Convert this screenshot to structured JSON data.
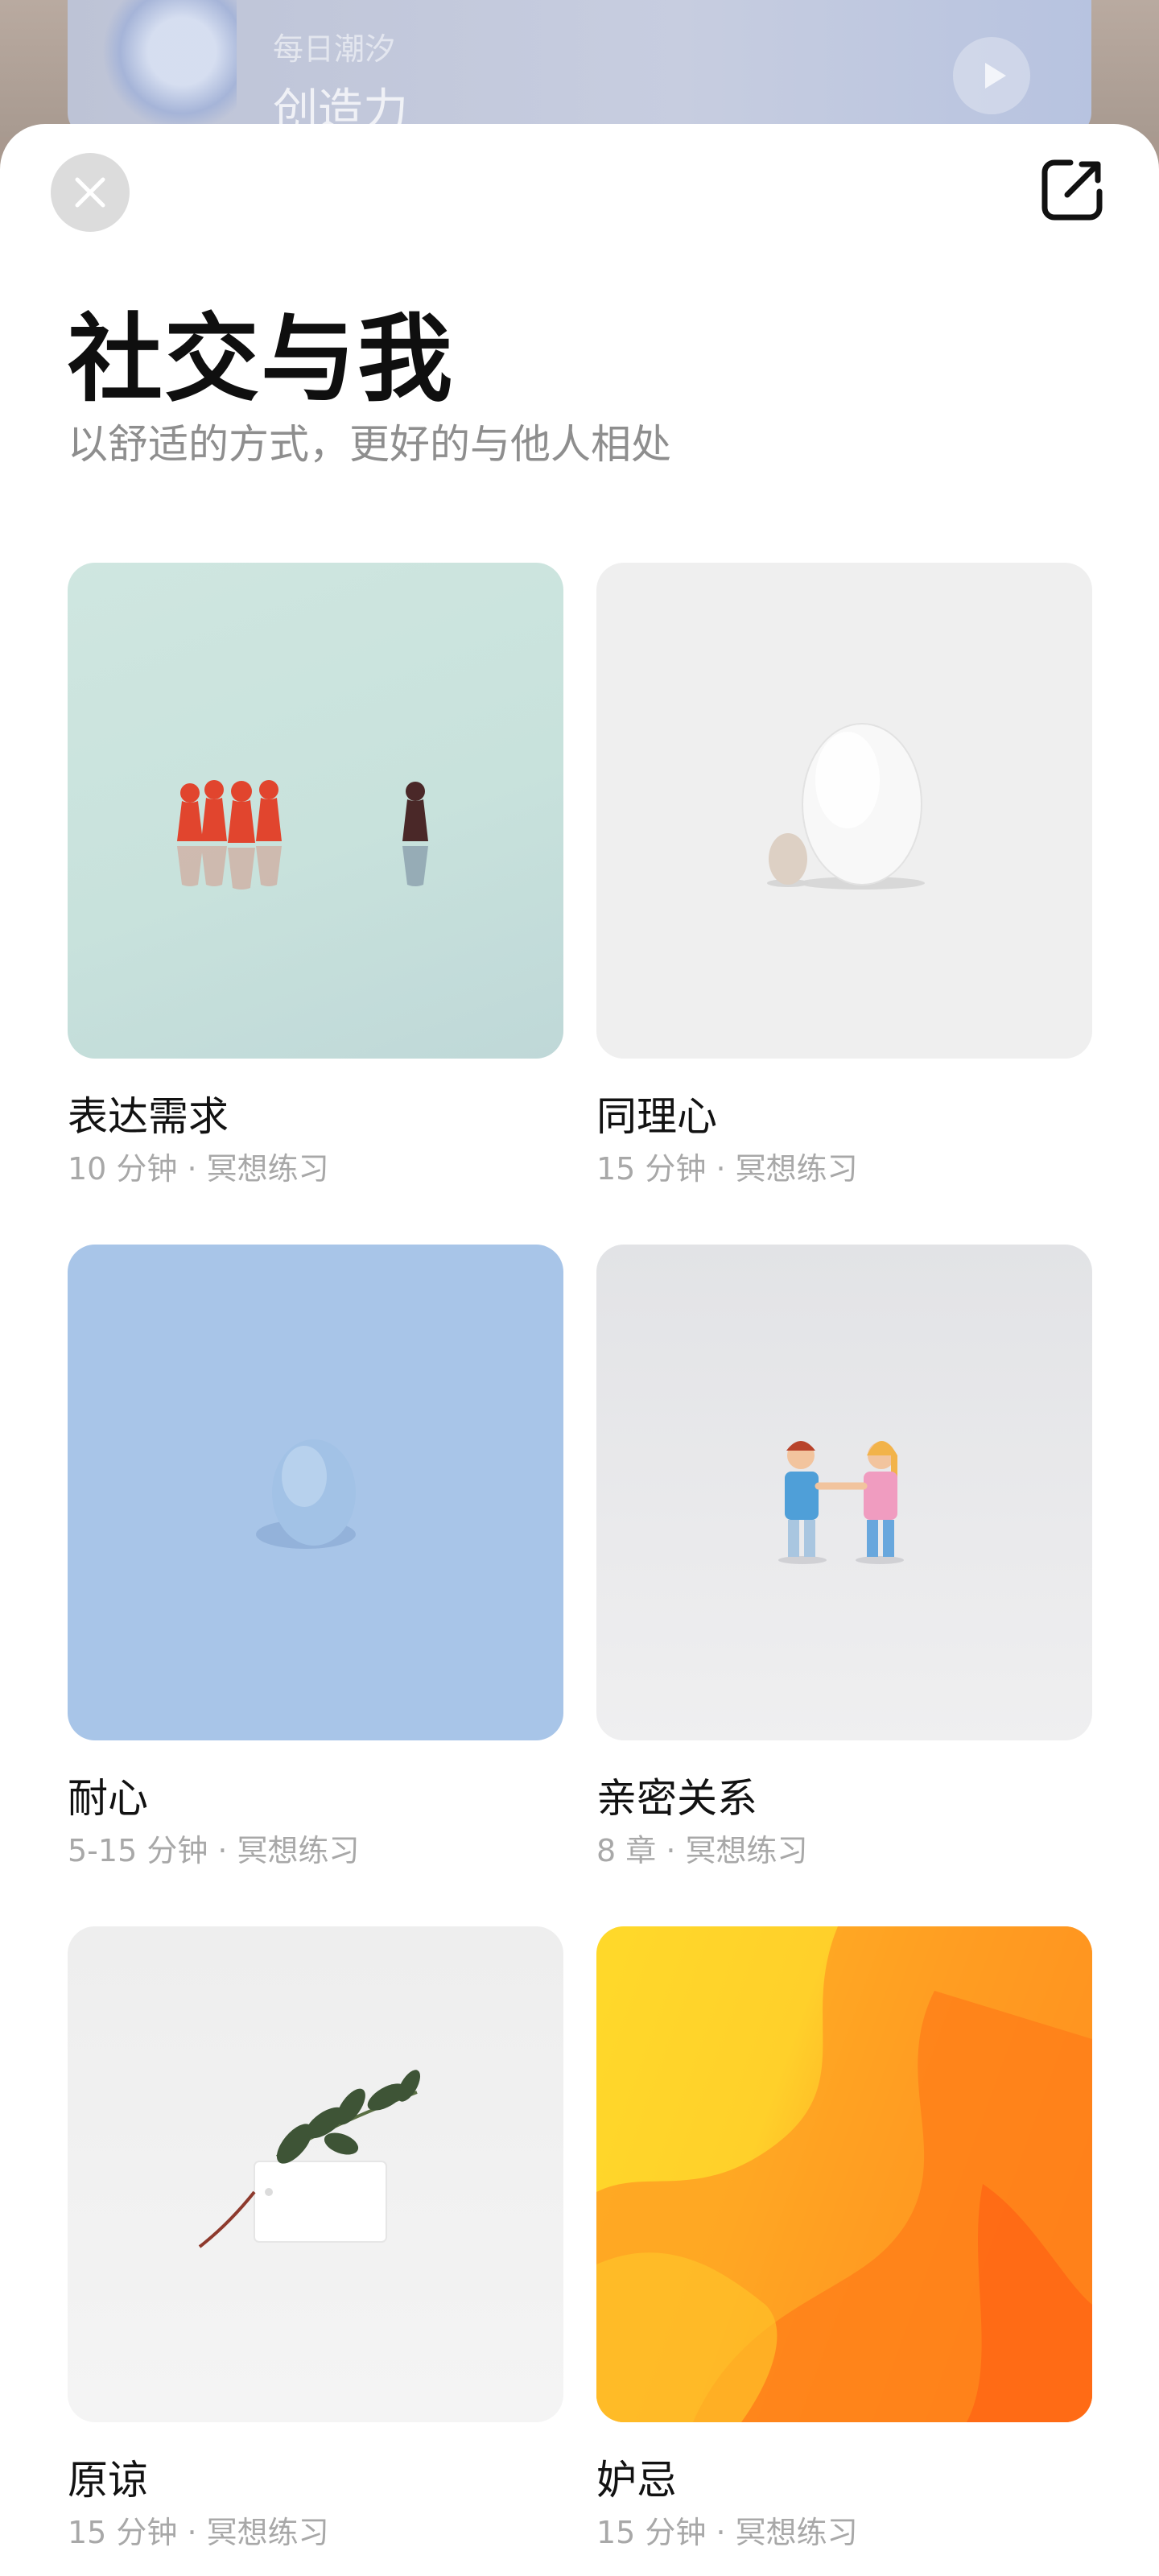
{
  "background": {
    "subtitle": "每日潮汐",
    "title": "创造力"
  },
  "header": {
    "title": "社交与我",
    "subtitle": "以舒适的方式，更好的与他人相处"
  },
  "items": [
    {
      "title": "表达需求",
      "meta": "10 分钟 · 冥想练习"
    },
    {
      "title": "同理心",
      "meta": "15 分钟 · 冥想练习"
    },
    {
      "title": "耐心",
      "meta": "5-15 分钟 · 冥想练习"
    },
    {
      "title": "亲密关系",
      "meta": "8 章 · 冥想练习"
    },
    {
      "title": "原谅",
      "meta": "15 分钟 · 冥想练习"
    },
    {
      "title": "妒忌",
      "meta": "15 分钟 · 冥想练习"
    }
  ],
  "icons": {
    "close": "close-icon",
    "share": "share-external-icon",
    "play": "play-icon"
  },
  "colors": {
    "sheet_background": "#ffffff",
    "title": "#0f0f0f",
    "subtitle": "#8e8e8e",
    "meta": "#a8a8a8"
  }
}
